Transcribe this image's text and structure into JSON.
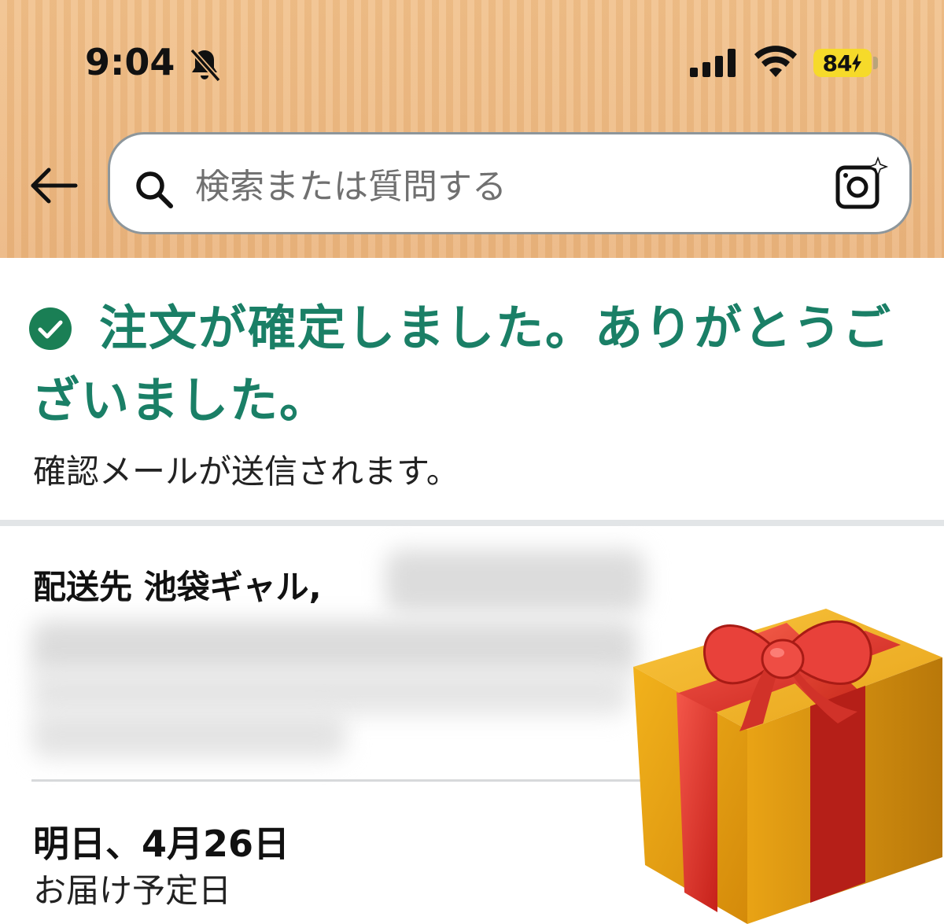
{
  "status_bar": {
    "time": "9:04",
    "battery_level": "84",
    "icons": [
      "bell-slash-icon",
      "cellular-signal-icon",
      "wifi-icon",
      "battery-charging-icon"
    ]
  },
  "header": {
    "back_icon": "back-arrow-icon",
    "search": {
      "placeholder": "検索または質問する",
      "search_icon": "search-icon",
      "camera_icon": "camera-lens-icon"
    }
  },
  "confirmation": {
    "icon": "check-circle-icon",
    "title": "注文が確定しました。ありがとうございました。",
    "subtitle": "確認メールが送信されます。"
  },
  "shipping": {
    "recipient_line": "配送先 池袋ギャル,",
    "delivery_date": "明日、4月26日",
    "delivery_label": "お届け予定日"
  },
  "decorations": {
    "gift_icon": "gift-box-emoji"
  },
  "colors": {
    "header_bg": "#ebb57e",
    "success_green": "#1a7f66",
    "battery_yellow": "#f6da2a"
  }
}
